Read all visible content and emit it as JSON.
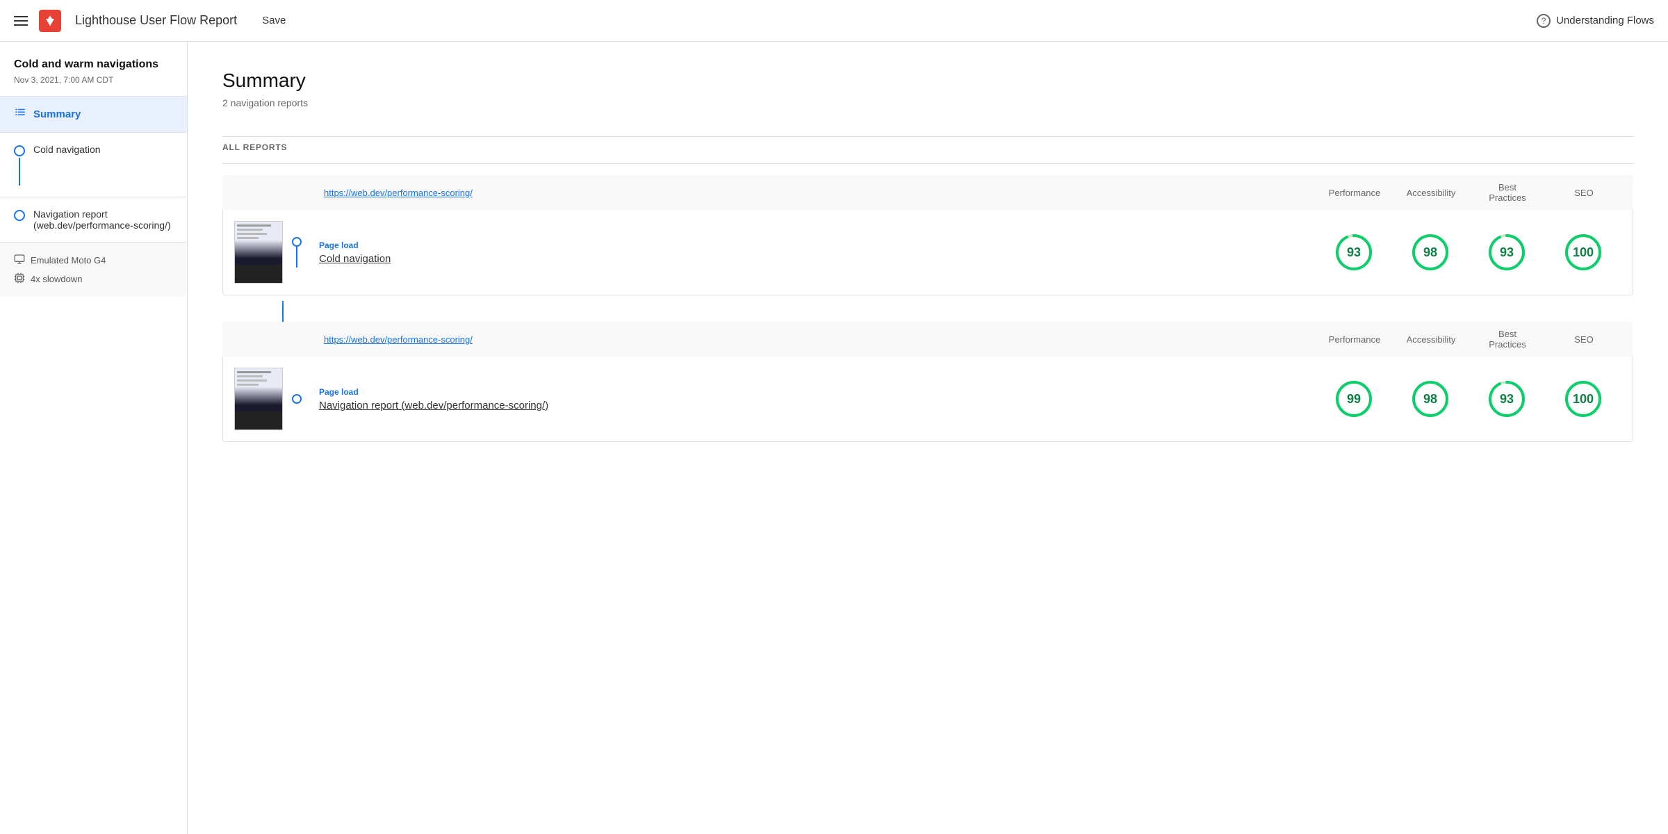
{
  "header": {
    "menu_icon": "hamburger-icon",
    "logo_icon": "lighthouse-icon",
    "logo_symbol": "🔦",
    "title": "Lighthouse User Flow Report",
    "save_label": "Save",
    "help_icon": "help-circle-icon",
    "understanding_flows_label": "Understanding Flows"
  },
  "sidebar": {
    "project_name": "Cold and warm navigations",
    "project_date": "Nov 3, 2021, 7:00 AM CDT",
    "summary_label": "Summary",
    "nav_items": [
      {
        "label": "Cold navigation",
        "has_connector": true
      },
      {
        "label": "Navigation report (web.dev/performance-scoring/)",
        "has_connector": false
      }
    ],
    "meta": [
      {
        "icon": "monitor-icon",
        "text": "Emulated Moto G4"
      },
      {
        "icon": "cpu-icon",
        "text": "4x slowdown"
      }
    ]
  },
  "main": {
    "summary_title": "Summary",
    "summary_subtitle": "2 navigation reports",
    "all_reports_label": "ALL REPORTS",
    "reports": [
      {
        "url": "https://web.dev/performance-scoring/",
        "columns": [
          "Performance",
          "Accessibility",
          "Best Practices",
          "SEO"
        ],
        "page_load_label": "Page load",
        "name": "Cold navigation",
        "scores": [
          93,
          98,
          93,
          100
        ],
        "score_max": 100
      },
      {
        "url": "https://web.dev/performance-scoring/",
        "columns": [
          "Performance",
          "Accessibility",
          "Best Practices",
          "SEO"
        ],
        "page_load_label": "Page load",
        "name": "Navigation report (web.dev/performance-scoring/)",
        "scores": [
          99,
          98,
          93,
          100
        ],
        "score_max": 100
      }
    ]
  },
  "colors": {
    "blue": "#1a73e8",
    "green_stroke": "#0cce6b",
    "green_bg": "#c8e6c9",
    "green_text": "#0d8043"
  }
}
